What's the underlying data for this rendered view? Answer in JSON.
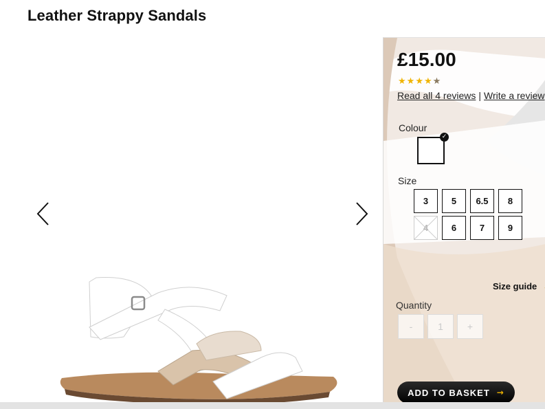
{
  "product": {
    "title": "Leather Strappy Sandals"
  },
  "gallery": {
    "prev_icon": "chevron-left-icon",
    "next_icon": "chevron-right-icon"
  },
  "purchase": {
    "price": "£15.00",
    "rating": 4.5,
    "rating_max": 5,
    "stars": [
      "★",
      "★",
      "★",
      "★",
      "★"
    ],
    "reviews_link": "Read all 4 reviews",
    "separator": "|",
    "write_review_link": "Write a review",
    "colour_label": "Colour",
    "colour_swatch": {
      "color": "#ffffff",
      "selected": true,
      "check_icon": "✓"
    },
    "size_label": "Size",
    "sizes": [
      {
        "label": "3",
        "available": true
      },
      {
        "label": "5",
        "available": true
      },
      {
        "label": "6.5",
        "available": true
      },
      {
        "label": "8",
        "available": true
      },
      {
        "label": "4",
        "available": false
      },
      {
        "label": "6",
        "available": true
      },
      {
        "label": "7",
        "available": true
      },
      {
        "label": "9",
        "available": true
      }
    ],
    "size_guide": "Size guide",
    "size_guide_arrow": "→",
    "quantity_label": "Quantity",
    "quantity_minus": "-",
    "quantity_value": "1",
    "quantity_plus": "+",
    "add_to_basket": "ADD TO BASKET",
    "add_to_basket_arrow": "→"
  },
  "colors": {
    "accent": "#f0b400",
    "text": "#111111",
    "button": "#000000"
  }
}
